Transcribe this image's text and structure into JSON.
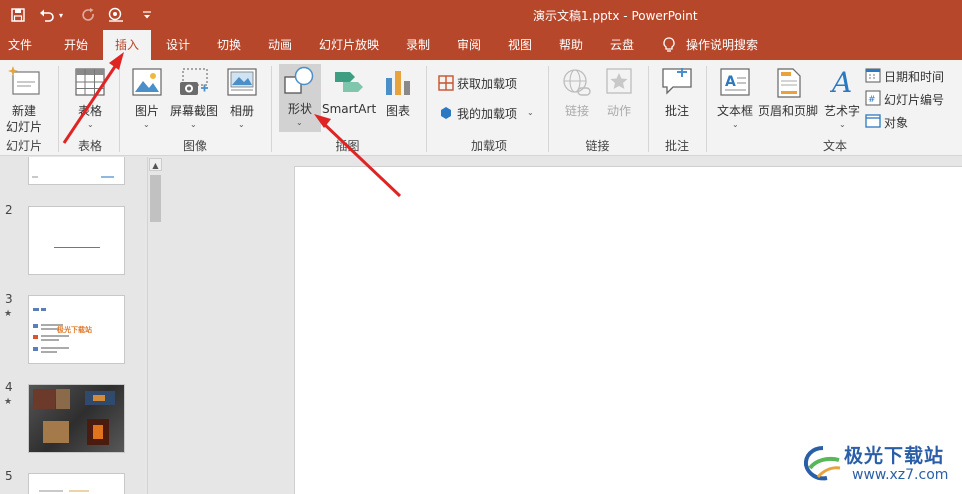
{
  "app": {
    "title": "演示文稿1.pptx  -  PowerPoint",
    "accent_color": "#b7472a"
  },
  "quick_access": {
    "icons": [
      "save-icon",
      "undo-icon",
      "redo-icon",
      "present-from-start-icon",
      "customize-icon"
    ]
  },
  "tabs": [
    {
      "label": "文件"
    },
    {
      "label": "开始"
    },
    {
      "label": "插入",
      "active": true
    },
    {
      "label": "设计"
    },
    {
      "label": "切换"
    },
    {
      "label": "动画"
    },
    {
      "label": "幻灯片放映"
    },
    {
      "label": "录制"
    },
    {
      "label": "审阅"
    },
    {
      "label": "视图"
    },
    {
      "label": "帮助"
    },
    {
      "label": "云盘"
    }
  ],
  "tellme": {
    "label": "操作说明搜索"
  },
  "ribbon": {
    "slides_group": {
      "label": "幻灯片",
      "new_slide_line1": "新建",
      "new_slide_line2": "幻灯片"
    },
    "tables_group": {
      "label": "表格",
      "table": "表格"
    },
    "images_group": {
      "label": "图像",
      "picture": "图片",
      "screenshot": "屏幕截图",
      "album": "相册"
    },
    "illustrations_group": {
      "label": "插图",
      "shapes": "形状",
      "smartart": "SmartArt",
      "chart": "图表"
    },
    "addins_group": {
      "label": "加载项",
      "get_addins": "获取加载项",
      "my_addins": "我的加载项"
    },
    "links_group": {
      "label": "链接",
      "link": "链接",
      "action": "动作"
    },
    "comments_group": {
      "label": "批注",
      "comment": "批注"
    },
    "text_group": {
      "label": "文本",
      "textbox": "文本框",
      "header_footer": "页眉和页脚",
      "wordart": "艺术字",
      "datetime": "日期和时间",
      "slide_number": "幻灯片编号",
      "object": "对象"
    }
  },
  "slides": [
    {
      "number": "2",
      "star": ""
    },
    {
      "number": "3",
      "star": "★"
    },
    {
      "number": "4",
      "star": "★"
    },
    {
      "number": "5",
      "star": ""
    }
  ],
  "thumb3": {
    "overlay": "极光下载站"
  },
  "watermark": {
    "text": "极光下载站",
    "url": "www.xz7.com"
  }
}
